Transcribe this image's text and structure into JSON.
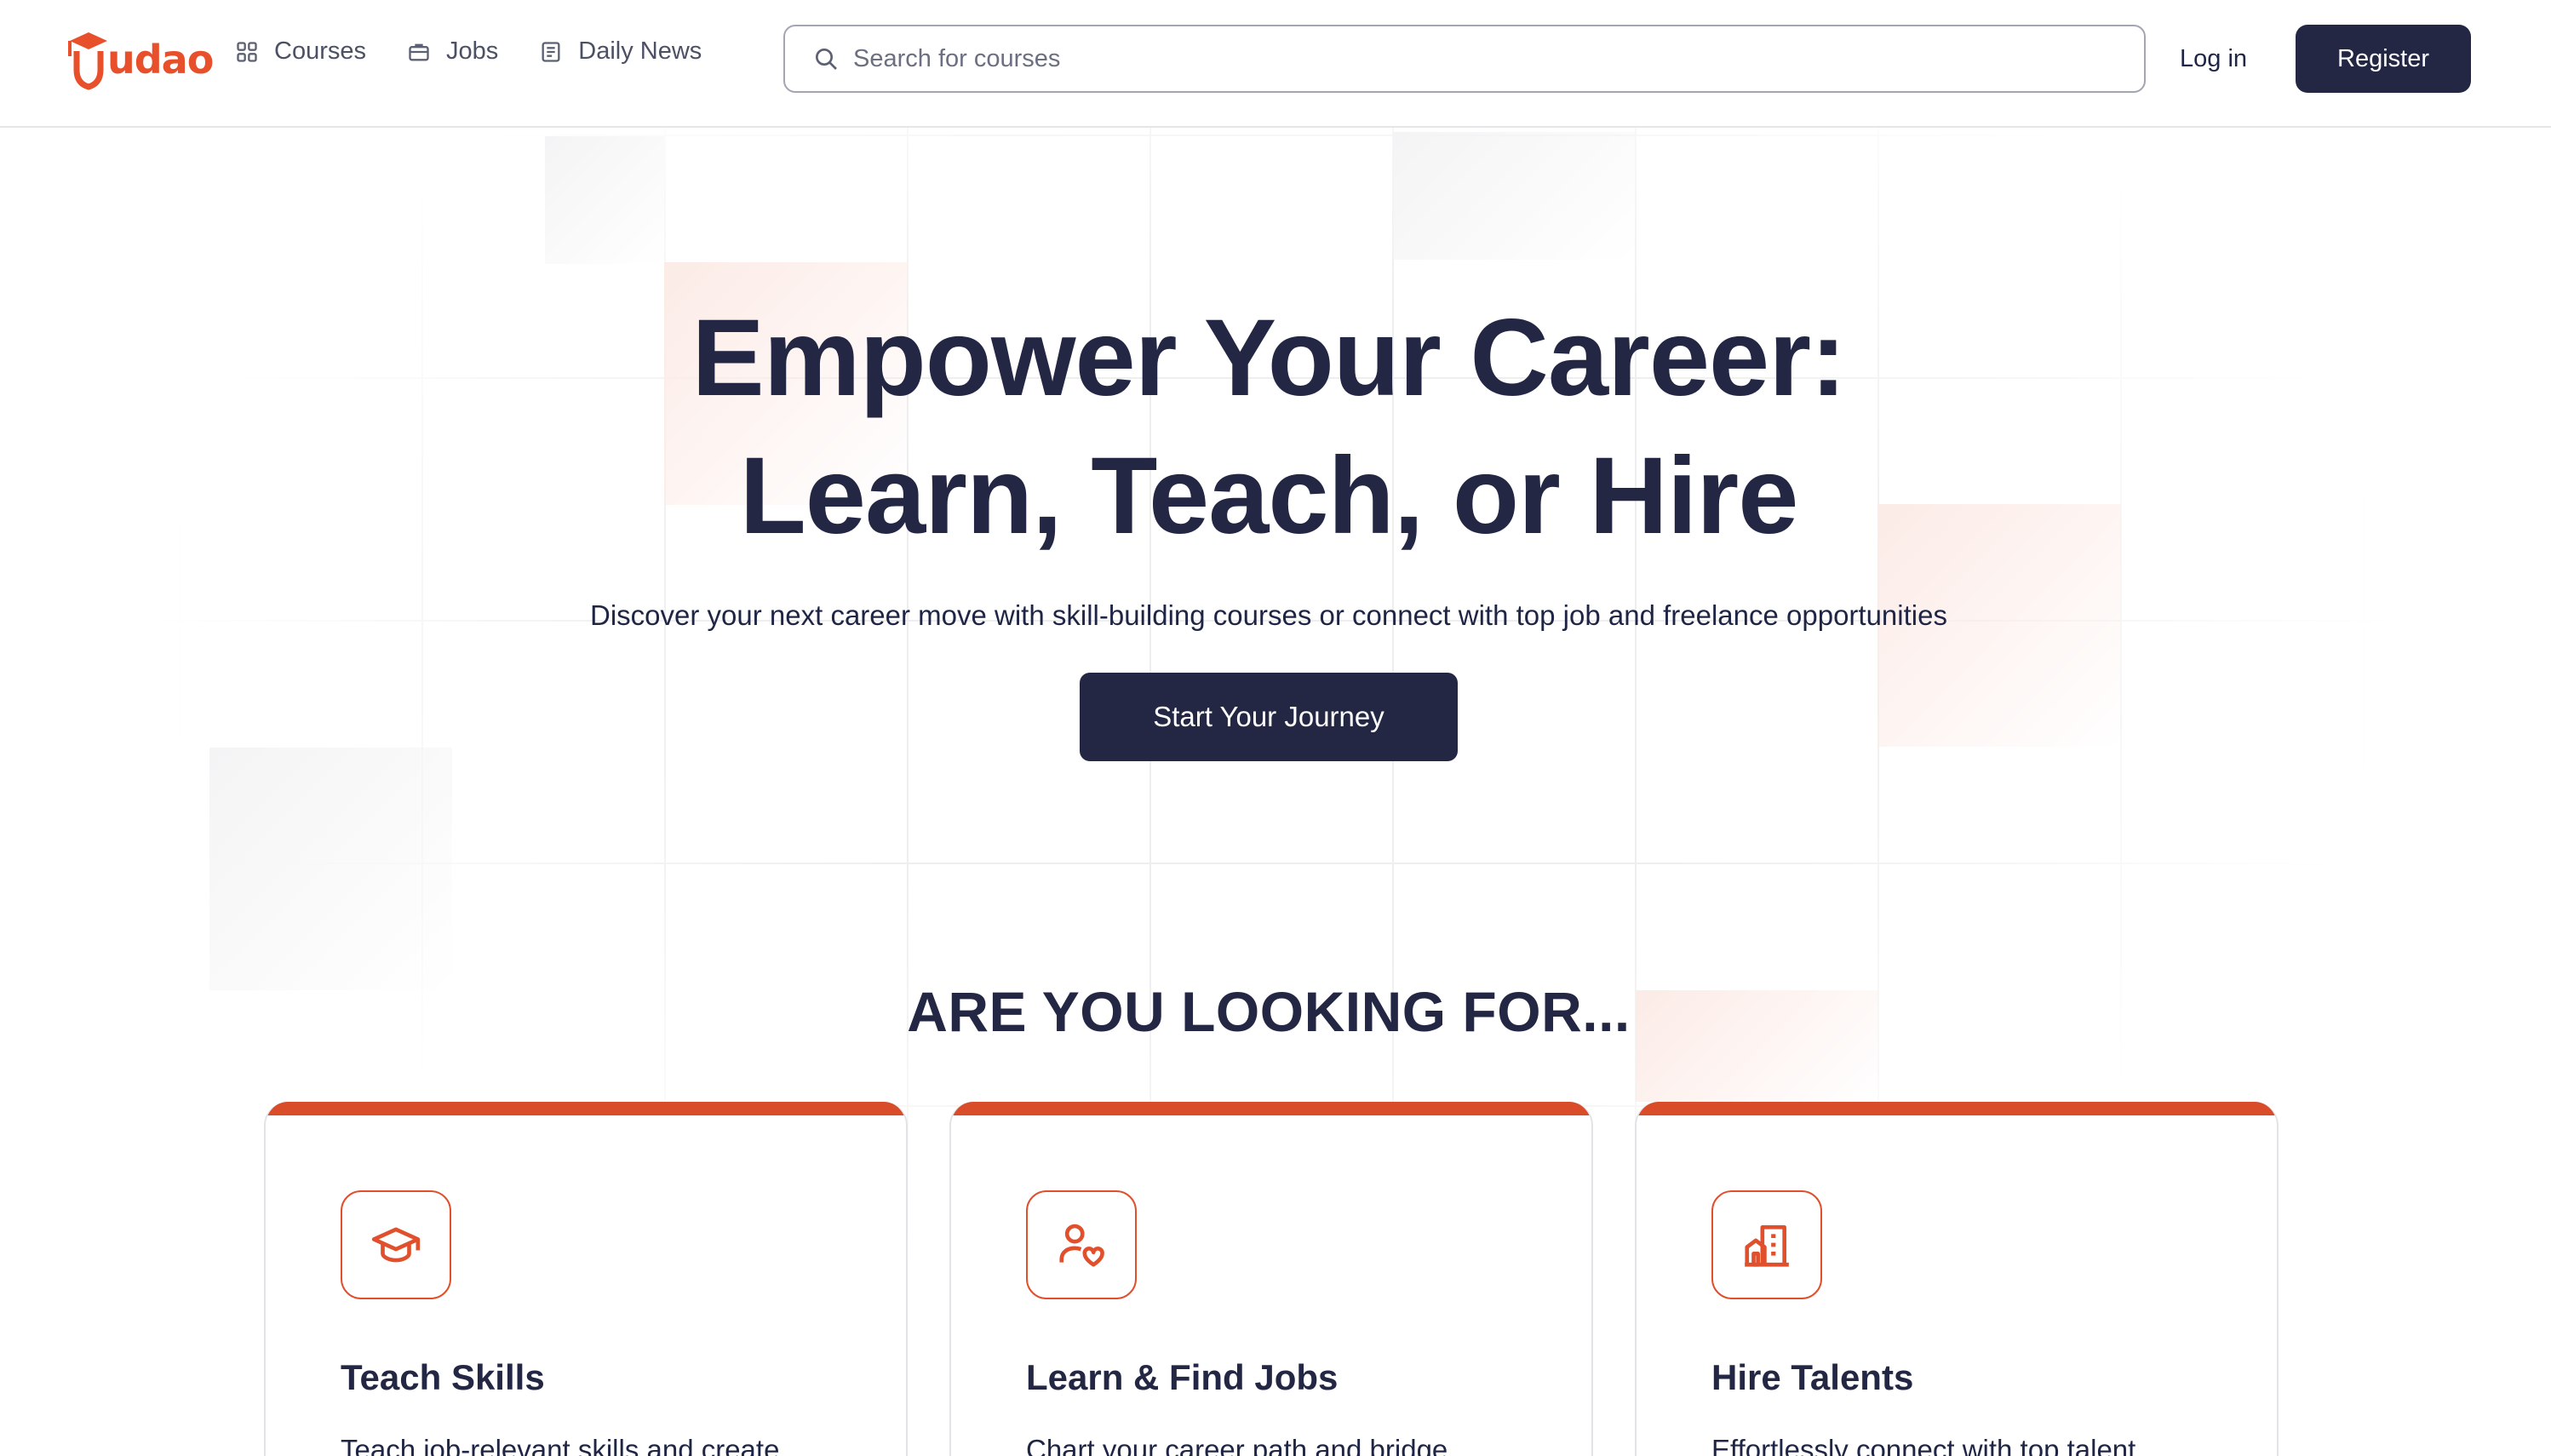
{
  "brand": {
    "logo_text": "udao",
    "accent": "#e8502b",
    "dark": "#232744"
  },
  "nav": {
    "items": [
      {
        "label": "Courses",
        "icon": "grid-icon"
      },
      {
        "label": "Jobs",
        "icon": "briefcase-icon"
      },
      {
        "label": "Daily News",
        "icon": "newspaper-icon"
      }
    ]
  },
  "search": {
    "placeholder": "Search for courses",
    "icon": "search-icon"
  },
  "auth": {
    "login_label": "Log in",
    "register_label": "Register"
  },
  "hero": {
    "title_line1": "Empower Your Career:",
    "title_line2": "Learn, Teach, or Hire",
    "subtitle": "Discover your next career move with skill-building courses or connect with top job and freelance opportunities",
    "cta_label": "Start Your Journey"
  },
  "section": {
    "title": "ARE YOU LOOKING FOR..."
  },
  "cards": [
    {
      "title": "Teach Skills",
      "description": "Teach job-relevant skills and create",
      "icon": "graduation-cap-icon"
    },
    {
      "title": "Learn & Find Jobs",
      "description": "Chart your career path and bridge",
      "icon": "user-heart-icon"
    },
    {
      "title": "Hire Talents",
      "description": "Effortlessly connect with top talent",
      "icon": "building-icon"
    }
  ]
}
